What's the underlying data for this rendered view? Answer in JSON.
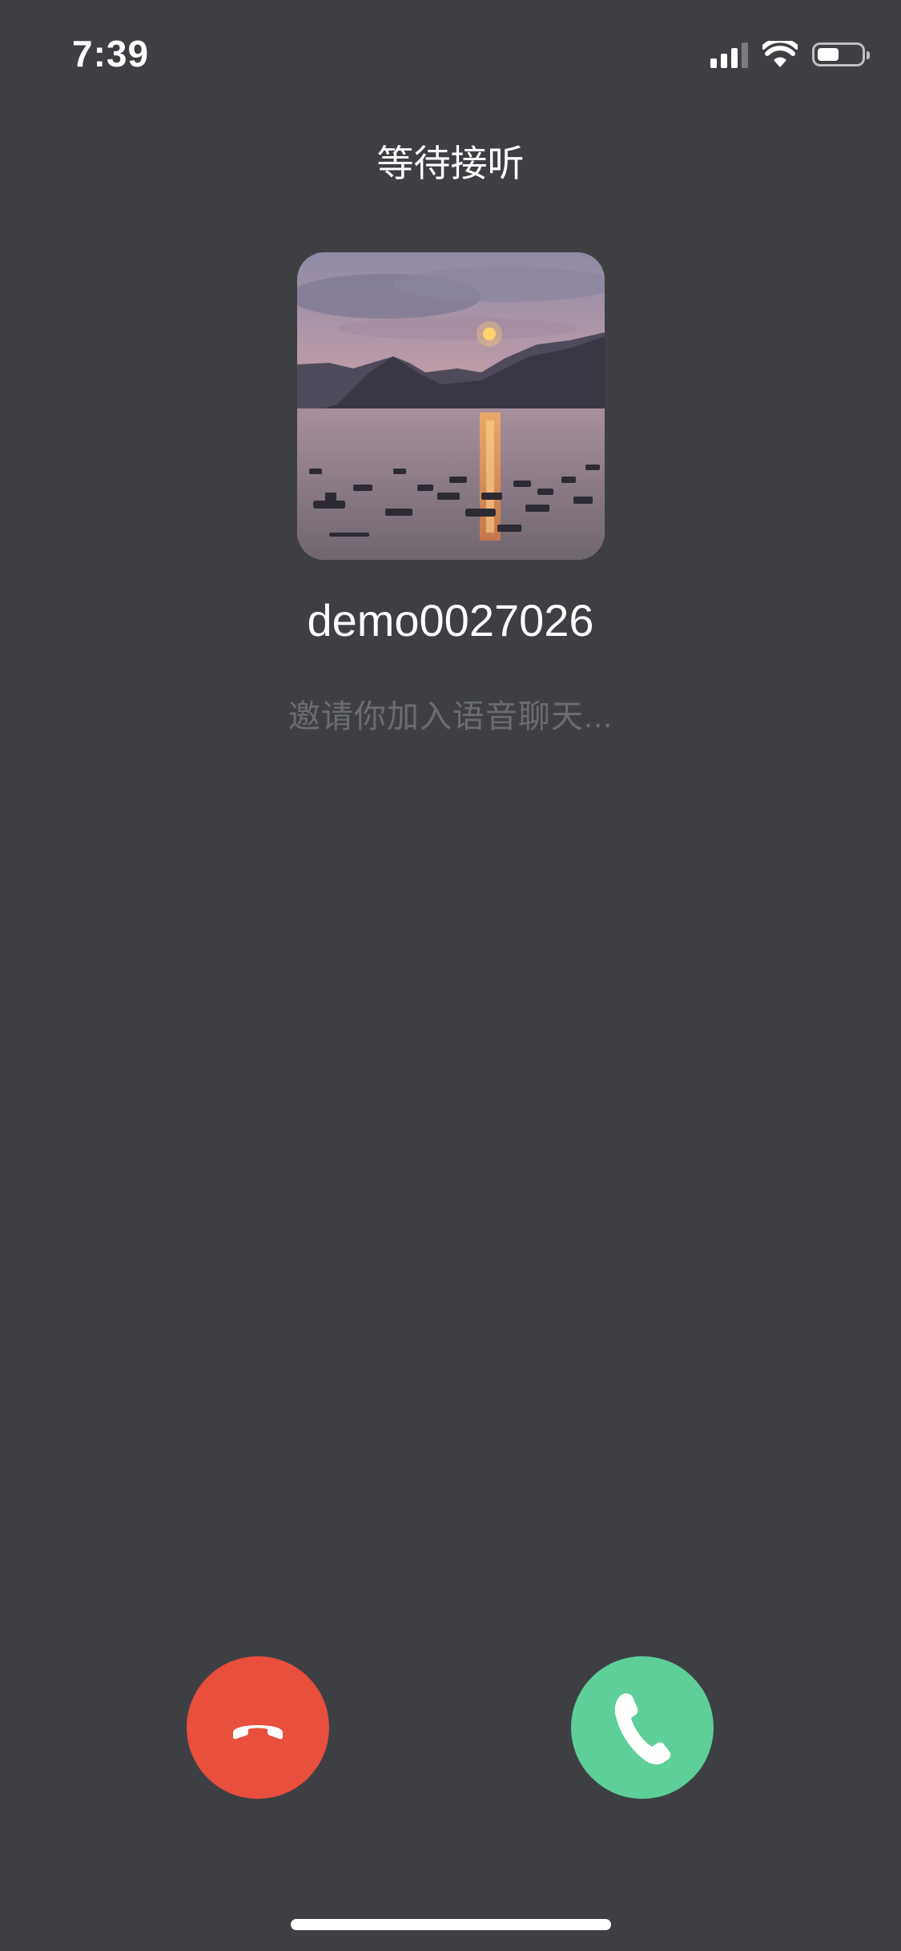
{
  "status_bar": {
    "time": "7:39",
    "icons": [
      "cellular-signal-icon",
      "wifi-icon",
      "battery-icon"
    ]
  },
  "call": {
    "title": "等待接听",
    "caller_name": "demo0027026",
    "subtitle": "邀请你加入语音聊天..."
  },
  "avatar": {
    "description_icon": "landscape-photo"
  },
  "actions": {
    "decline_icon": "hang-up-phone-icon",
    "accept_icon": "phone-icon"
  },
  "colors": {
    "background": "#3d3f43",
    "decline": "#e84f3d",
    "accept": "#5fcf9a",
    "subtitle_text": "#6b6d71"
  }
}
